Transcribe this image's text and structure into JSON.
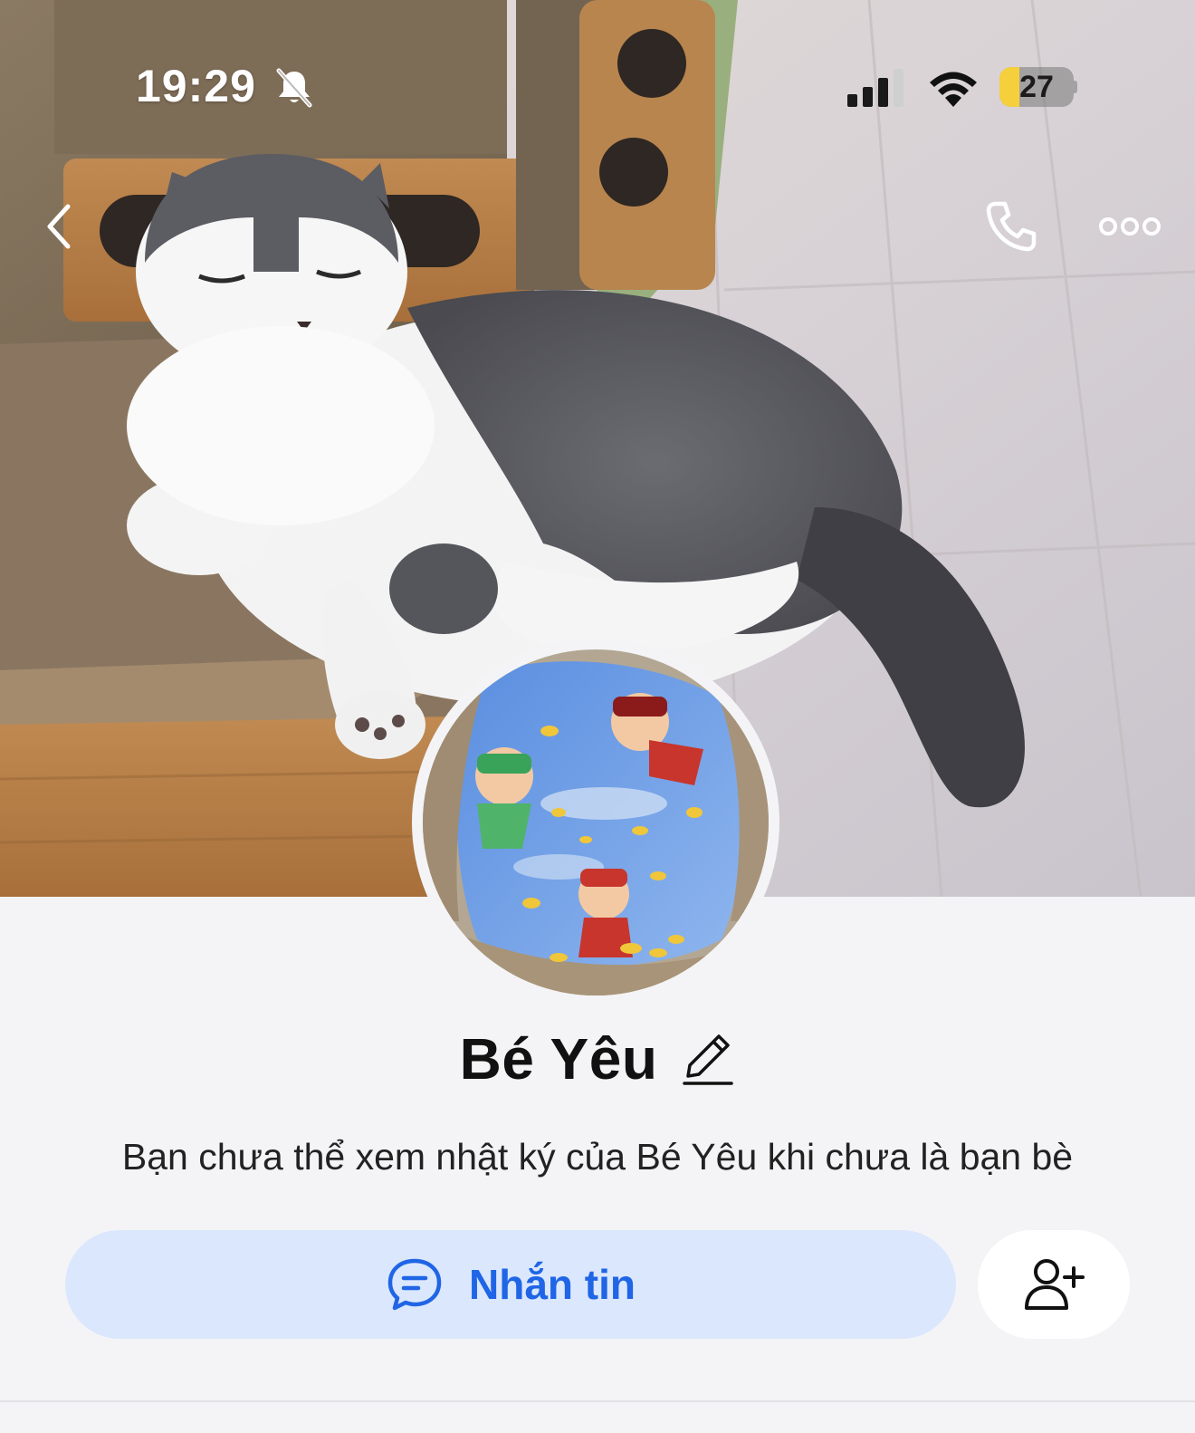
{
  "status_bar": {
    "time": "19:29",
    "battery_level": "27",
    "battery_fraction": 0.27
  },
  "cover": {
    "description_icon": "cat-cover-photo"
  },
  "nav": {
    "back_icon": "chevron-left-icon",
    "call_icon": "phone-icon",
    "more_icon": "more-dots-icon"
  },
  "profile": {
    "name": "Bé Yêu",
    "diary_notice": "Bạn chưa thể xem nhật ký của Bé Yêu khi chưa là bạn bè"
  },
  "actions": {
    "message_label": "Nhắn tin",
    "message_icon": "chat-bubble-icon",
    "add_friend_icon": "add-user-icon"
  },
  "colors": {
    "accent": "#1f65e6",
    "message_bg": "#dbe7fd",
    "page_bg": "#f4f4f6",
    "battery_fill": "#f6d03c"
  }
}
